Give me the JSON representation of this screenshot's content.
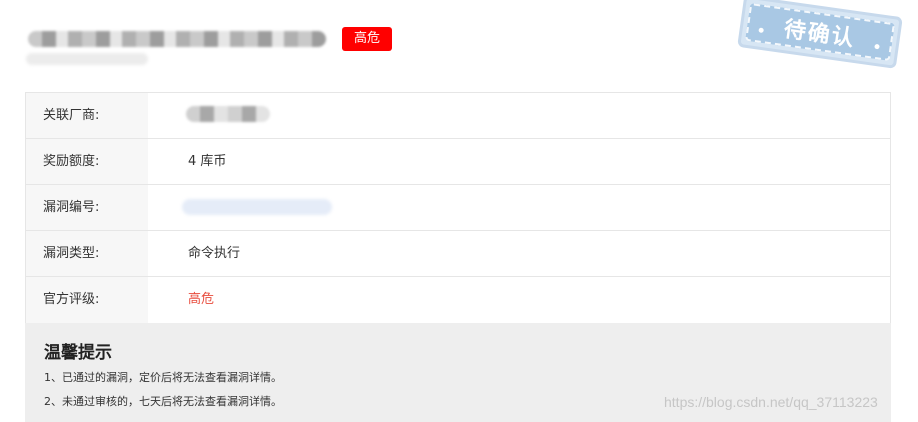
{
  "header": {
    "severity_badge": "高危"
  },
  "stamp": {
    "text": "待确认"
  },
  "details": [
    {
      "label": "关联厂商:",
      "value": ""
    },
    {
      "label": "奖励额度:",
      "value": "4 库币"
    },
    {
      "label": "漏洞编号:",
      "value": ""
    },
    {
      "label": "漏洞类型:",
      "value": "命令执行"
    },
    {
      "label": "官方评级:",
      "value": "高危"
    }
  ],
  "tips": {
    "title": "温馨提示",
    "items": [
      "1、已通过的漏洞，定价后将无法查看漏洞详情。",
      "2、未通过审核的，七天后将无法查看漏洞详情。"
    ]
  },
  "watermark": "https://blog.csdn.net/qq_37113223",
  "colors": {
    "badge": "#ff0000",
    "rating_text": "#e84c3d",
    "stamp": "#a9c8e4",
    "tips_bg": "#eeeeee"
  }
}
